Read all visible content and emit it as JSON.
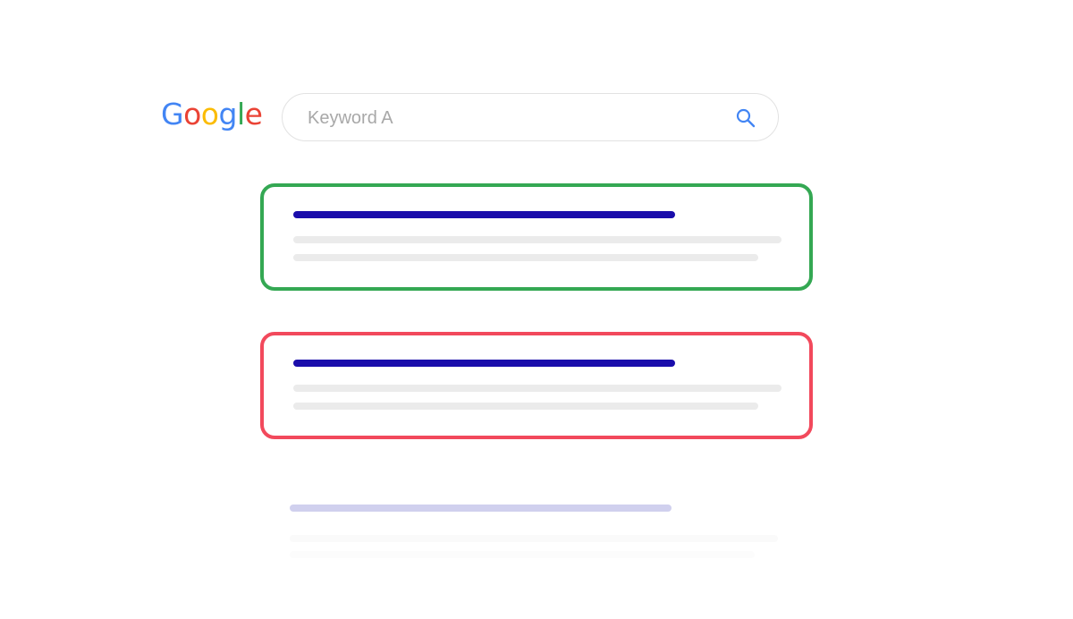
{
  "logo": {
    "text": "Google",
    "letters": [
      {
        "char": "G",
        "color": "#4285F4"
      },
      {
        "char": "o",
        "color": "#EA4335"
      },
      {
        "char": "o",
        "color": "#FBBC05"
      },
      {
        "char": "g",
        "color": "#4285F4"
      },
      {
        "char": "l",
        "color": "#34A853"
      },
      {
        "char": "e",
        "color": "#EA4335"
      }
    ]
  },
  "search": {
    "placeholder": "Keyword A",
    "icon": "search-icon",
    "icon_color": "#4285F4"
  },
  "results": [
    {
      "status": "highlight-good",
      "border_color": "#34A853",
      "title_color": "#1A0DAB",
      "snippet_color": "#EBEBEB"
    },
    {
      "status": "highlight-bad",
      "border_color": "#F2495C",
      "title_color": "#1A0DAB",
      "snippet_color": "#EBEBEB"
    },
    {
      "status": "faded",
      "border_color": "",
      "title_color": "#D0D0EE",
      "snippet_color": "#F6F6F6"
    }
  ]
}
